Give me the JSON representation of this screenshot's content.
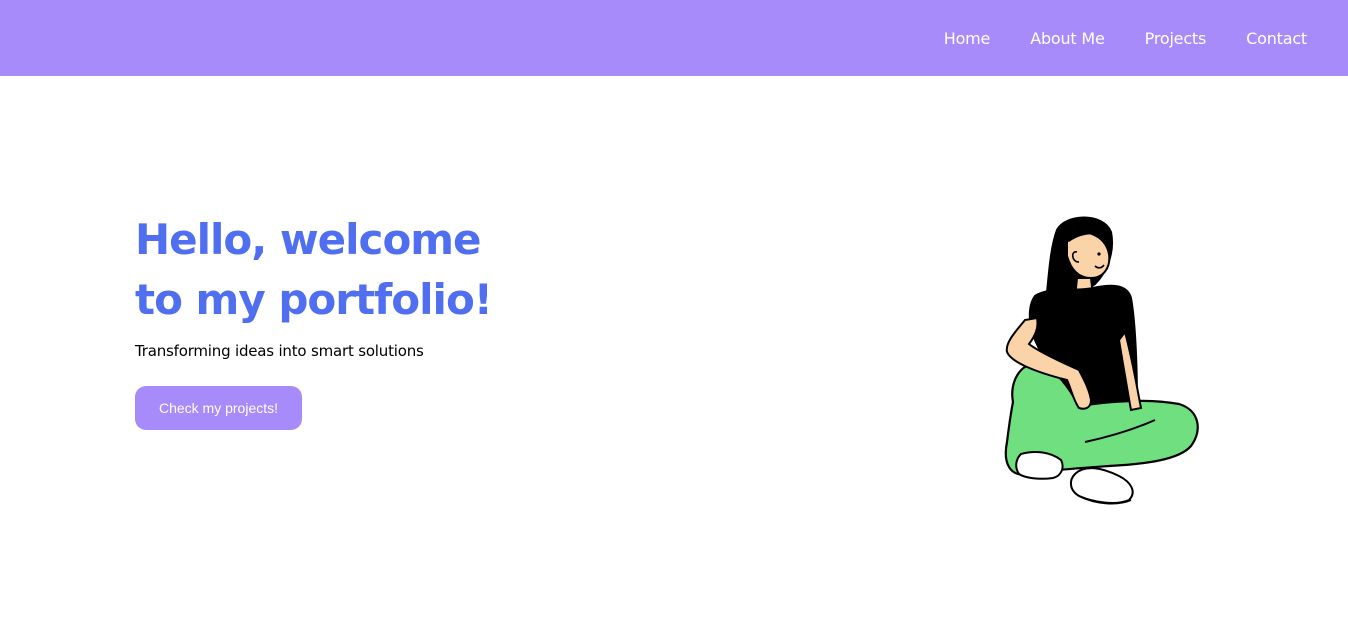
{
  "navbar": {
    "links": [
      {
        "label": "Home"
      },
      {
        "label": "About Me"
      },
      {
        "label": "Projects"
      },
      {
        "label": "Contact"
      }
    ]
  },
  "hero": {
    "title_line_1": "Hello, welcome",
    "title_line_2": "to my portfolio!",
    "subtitle": "Transforming ideas into smart solutions",
    "cta_label": "Check my projects!"
  },
  "illustration": {
    "icon": "sitting-woman-illustration"
  },
  "colors": {
    "navbar_bg": "#a78bfa",
    "title": "#4f6ef0",
    "button_bg": "#a78bfa",
    "shirt": "#000000",
    "pants": "#6fdf7f",
    "skin": "#fbd3a8"
  }
}
